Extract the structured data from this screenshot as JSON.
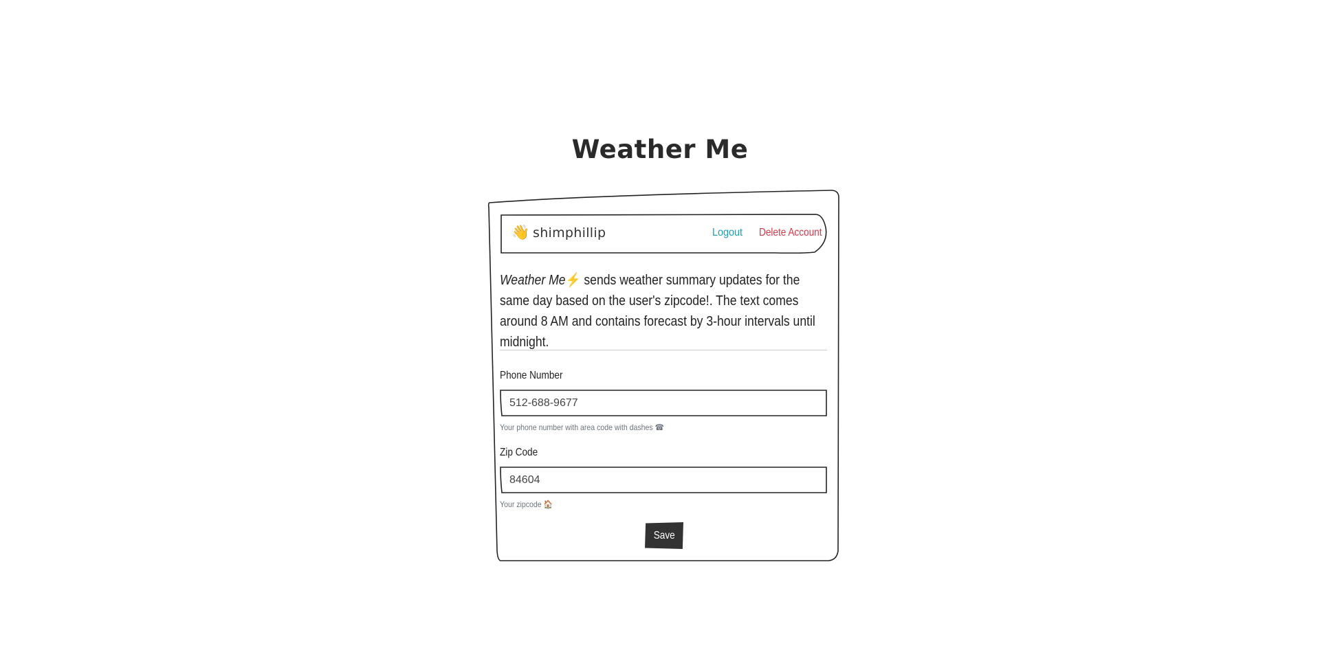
{
  "app": {
    "title": "Weather Me"
  },
  "user_bar": {
    "wave_icon": "👋",
    "username": "shimphillip",
    "logout_label": "Logout",
    "delete_label": "Delete Account"
  },
  "description": {
    "brand": "Weather Me",
    "bolt_icon": "⚡",
    "text": " sends weather summary updates for the same day based on the user's zipcode!. The text comes around 8 AM and contains forecast by 3-hour intervals until midnight."
  },
  "form": {
    "phone": {
      "label": "Phone Number",
      "value": "512-688-9677",
      "help": "Your phone number with area code with dashes ☎"
    },
    "zip": {
      "label": "Zip Code",
      "value": "84604",
      "help": "Your zipcode 🏠"
    },
    "save_label": "Save"
  },
  "colors": {
    "logout": "#17a2b8",
    "delete": "#dc3545",
    "save_bg": "#333333",
    "help_text": "#6c757d"
  }
}
